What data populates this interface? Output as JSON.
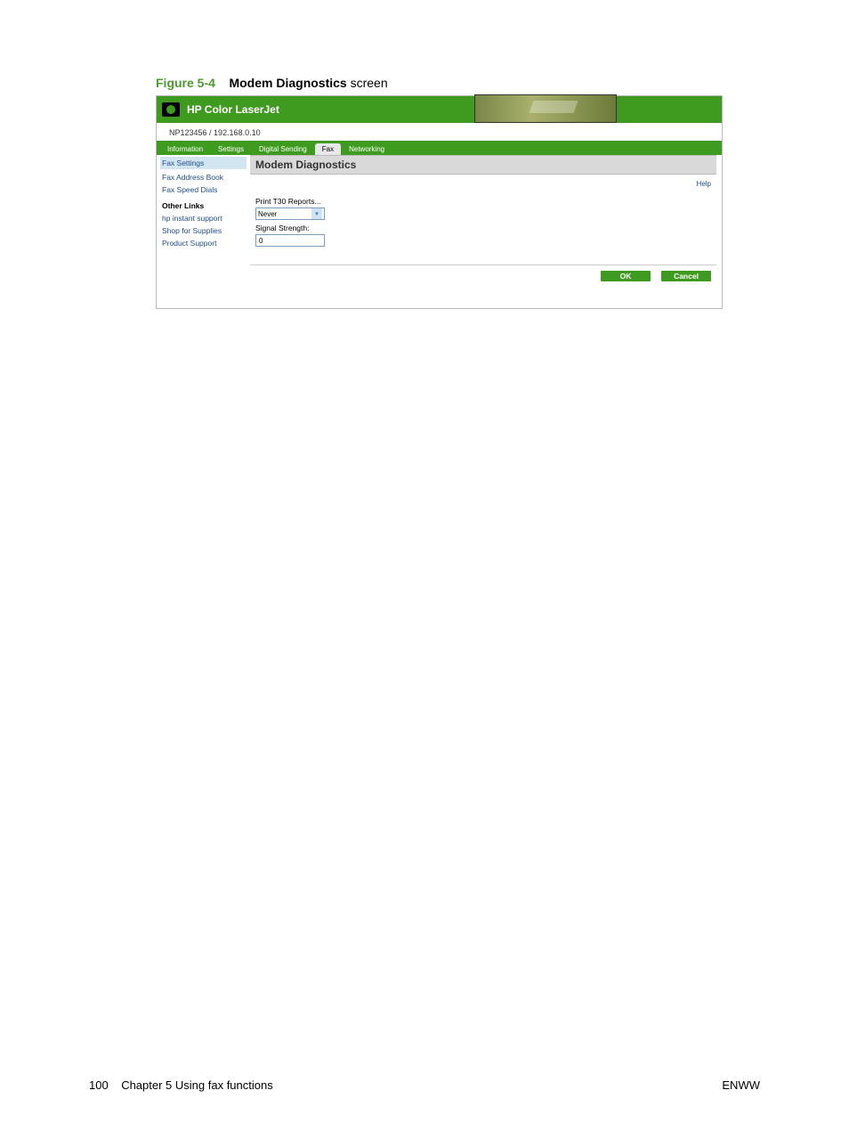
{
  "caption": {
    "fig_num": "Figure 5-4",
    "bold": "Modem Diagnostics",
    "rest": " screen"
  },
  "header": {
    "product_title": "HP Color LaserJet",
    "device_info": "NP123456 / 192.168.0.10"
  },
  "tabs": [
    "Information",
    "Settings",
    "Digital Sending",
    "Fax",
    "Networking"
  ],
  "sidebar": {
    "selected": "Fax Settings",
    "links": [
      "Fax Address Book",
      "Fax Speed Dials"
    ],
    "other_heading": "Other Links",
    "other_links": [
      "hp instant support",
      "Shop for Supplies",
      "Product Support"
    ]
  },
  "content": {
    "title": "Modem Diagnostics",
    "help": "Help",
    "print_label": "Print T30 Reports...",
    "print_select_value": "Never",
    "signal_label": "Signal Strength:",
    "signal_value": "0",
    "ok": "OK",
    "cancel": "Cancel"
  },
  "footer": {
    "left_page": "100",
    "left_chapter": "Chapter 5   Using fax functions",
    "right": "ENWW"
  }
}
